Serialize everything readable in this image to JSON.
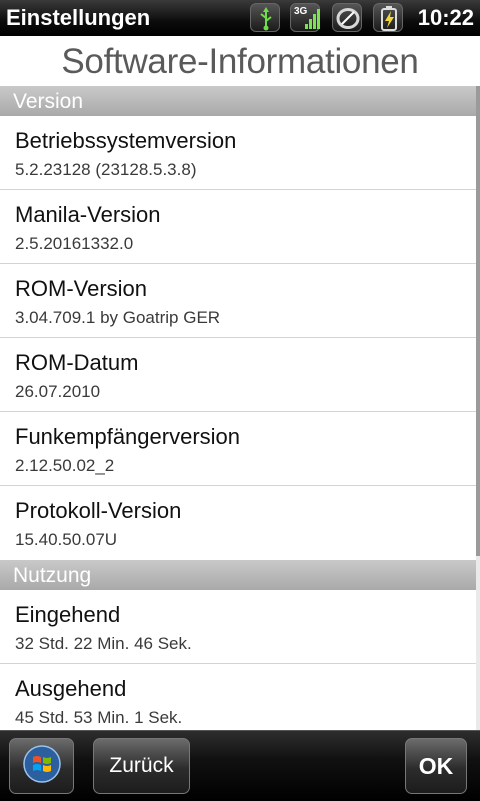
{
  "status_bar": {
    "title": "Einstellungen",
    "time": "10:22",
    "network_label": "3G",
    "icons": [
      "usb-icon",
      "signal-3g-icon",
      "data-sync-icon",
      "battery-charging-icon"
    ]
  },
  "header": {
    "title": "Software-Informationen"
  },
  "sections": [
    {
      "title": "Version",
      "items": [
        {
          "label": "Betriebssystemversion",
          "value": "5.2.23128 (23128.5.3.8)"
        },
        {
          "label": "Manila-Version",
          "value": "2.5.20161332.0"
        },
        {
          "label": "ROM-Version",
          "value": "3.04.709.1 by Goatrip GER"
        },
        {
          "label": "ROM-Datum",
          "value": "26.07.2010"
        },
        {
          "label": "Funkempfängerversion",
          "value": "2.12.50.02_2"
        },
        {
          "label": "Protokoll-Version",
          "value": "15.40.50.07U"
        }
      ]
    },
    {
      "title": "Nutzung",
      "items": [
        {
          "label": "Eingehend",
          "value": "32 Std. 22 Min. 46 Sek."
        },
        {
          "label": "Ausgehend",
          "value": "45 Std. 53 Min. 1 Sek."
        }
      ]
    }
  ],
  "bottom_bar": {
    "start_icon": "windows-start-icon",
    "back_label": "Zurück",
    "ok_label": "OK"
  },
  "colors": {
    "section_header": "#b8b8b8",
    "title_text": "#5a5a5a",
    "bar_background": "#000000"
  }
}
